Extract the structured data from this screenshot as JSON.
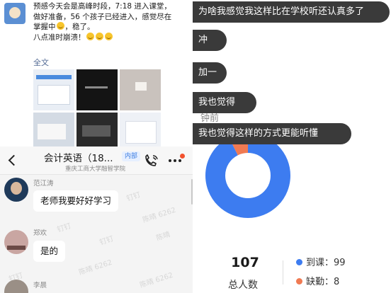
{
  "moments": {
    "post_lines": [
      "预感今天会是高峰时段，7:18 进入课堂，",
      "做好准备，56 个孩子已经进入，感觉尽在",
      "掌握中",
      "，稳了。",
      "八点准时崩溃！"
    ],
    "full_text_link": "全文",
    "thumbnails": 6
  },
  "chat": {
    "back_icon": "chevron-left-icon",
    "title": "会计英语（18...",
    "tag": "内部",
    "subtitle": "重庆工商大学融智学院",
    "call_icon": "phone-icon",
    "more_icon": "more-dots-icon",
    "badge_color": "#f2522e",
    "messages": [
      {
        "sender": "范江涛",
        "text": "老师我要好好学习"
      },
      {
        "sender": "郑欢",
        "text": "是的"
      },
      {
        "sender": "李晨",
        "text": ""
      }
    ]
  },
  "live": {
    "danmu": [
      "为啥我感觉我这样比在学校听还认真多了",
      "冲",
      "加一",
      "我也觉得",
      "我也觉得这样的方式更能听懂"
    ],
    "behind_text": "钟前",
    "stats": {
      "total": "107",
      "total_label": "总人数",
      "present_label": "到课：99",
      "absent_label": "缺勤：8"
    },
    "chart_data": {
      "type": "pie",
      "categories": [
        "到课",
        "缺勤"
      ],
      "values": [
        99,
        8
      ],
      "colors": [
        "#3d7cf0",
        "#f07a52"
      ]
    }
  }
}
